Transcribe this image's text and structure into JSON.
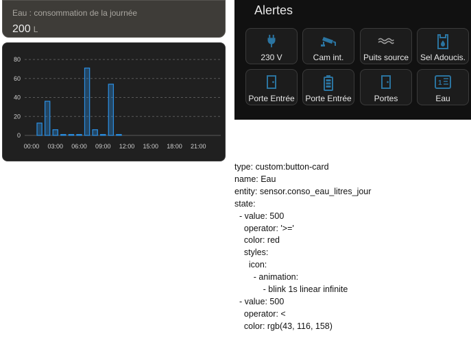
{
  "sensor_card": {
    "title": "Eau : consommation de la journée",
    "value": "200",
    "unit": "L"
  },
  "chart_data": {
    "type": "bar",
    "title": "",
    "xlabel": "",
    "ylabel": "",
    "ylim": [
      0,
      80
    ],
    "y_ticks": [
      "0",
      "20",
      "40",
      "60",
      "80"
    ],
    "x_ticks": [
      "00:00",
      "03:00",
      "06:00",
      "09:00",
      "12:00",
      "15:00",
      "18:00",
      "21:00"
    ],
    "grid": true,
    "bars": [
      {
        "x": 1,
        "value": 13
      },
      {
        "x": 2,
        "value": 36
      },
      {
        "x": 3,
        "value": 6
      },
      {
        "x": 4,
        "value": 1
      },
      {
        "x": 5,
        "value": 1
      },
      {
        "x": 6,
        "value": 1
      },
      {
        "x": 7,
        "value": 71
      },
      {
        "x": 8,
        "value": 6
      },
      {
        "x": 9,
        "value": 1
      },
      {
        "x": 10,
        "value": 54
      },
      {
        "x": 11,
        "value": 1
      }
    ],
    "color": "#2b8fe3"
  },
  "alerts": {
    "title": "Alertes",
    "tiles": [
      {
        "label": "230 V",
        "icon": "power-plug-icon",
        "state": "active"
      },
      {
        "label": "Cam int.",
        "icon": "cctv-icon",
        "state": "normal"
      },
      {
        "label": "Puits source",
        "icon": "water-waves-icon",
        "state": "unavailable"
      },
      {
        "label": "Sel Adoucis.",
        "icon": "water-softener-icon",
        "state": "normal"
      },
      {
        "label": "Porte Entrée",
        "icon": "door-icon",
        "state": "normal"
      },
      {
        "label": "Porte Entrée",
        "icon": "battery-icon",
        "state": "normal"
      },
      {
        "label": "Portes",
        "icon": "door-icon",
        "state": "normal"
      },
      {
        "label": "Eau",
        "icon": "meter-icon",
        "state": "normal"
      }
    ],
    "colors": {
      "icon": "#2b74a0",
      "icon_muted": "#9a9a9a"
    }
  },
  "yaml_lines": [
    "type: custom:button-card",
    "name: Eau",
    "entity: sensor.conso_eau_litres_jour",
    "state:",
    "  - value: 500",
    "    operator: '>='",
    "    color: red",
    "    styles:",
    "      icon:",
    "        - animation:",
    "            - blink 1s linear infinite",
    "  - value: 500",
    "    operator: <",
    "    color: rgb(43, 116, 158)"
  ]
}
